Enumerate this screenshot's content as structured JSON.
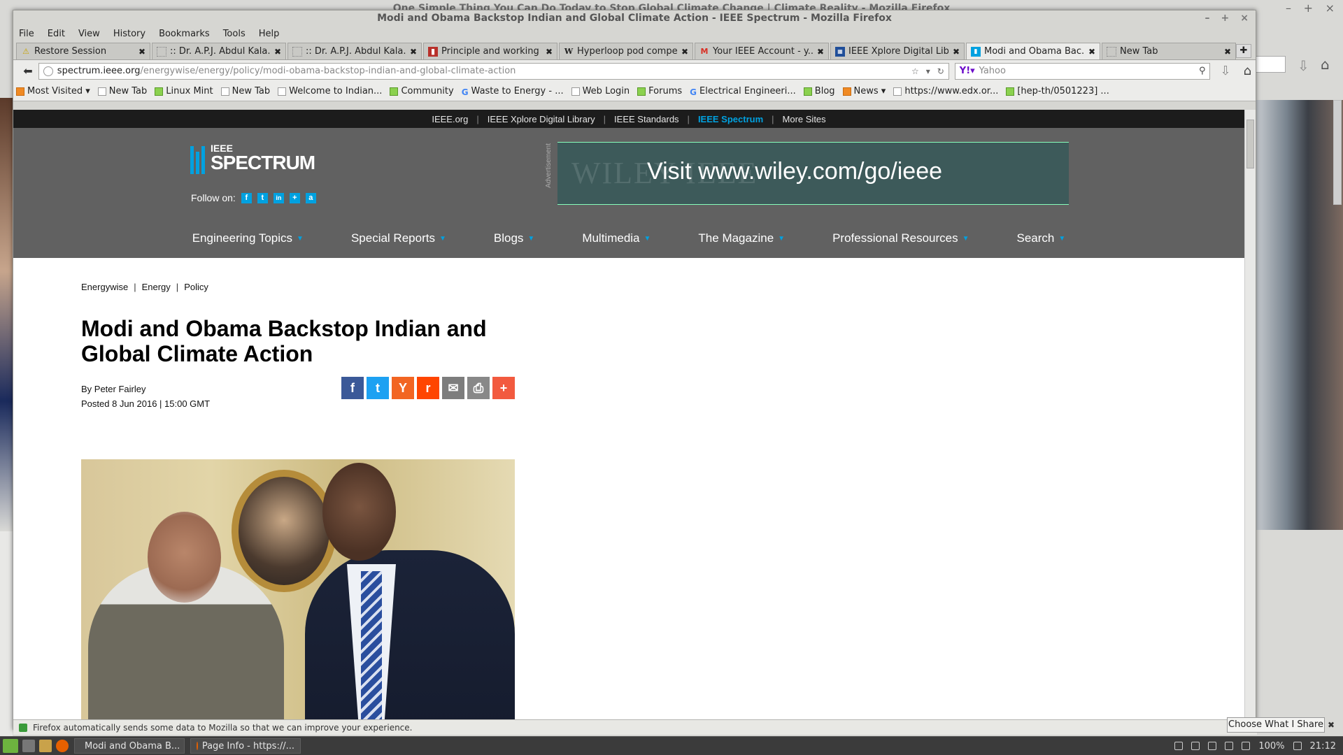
{
  "background": {
    "title": "One Simple Thing You Can Do Today to Stop Global Climate Change | Climate Reality - Mozilla Firefox"
  },
  "window": {
    "title": "Modi and Obama Backstop Indian and Global Climate Action - IEEE Spectrum - Mozilla Firefox",
    "controls": [
      "–",
      "+",
      "×"
    ]
  },
  "menu": [
    "File",
    "Edit",
    "View",
    "History",
    "Bookmarks",
    "Tools",
    "Help"
  ],
  "tabs": [
    {
      "label": "Restore Session",
      "icon": "warning-icon",
      "active": false
    },
    {
      "label": ":: Dr. A.P.J. Abdul Kala...",
      "icon": "page-icon",
      "active": false
    },
    {
      "label": ":: Dr. A.P.J. Abdul Kala...",
      "icon": "page-icon",
      "active": false
    },
    {
      "label": "Principle and working ...",
      "icon": "pdf-icon",
      "active": false
    },
    {
      "label": "Hyperloop pod compe...",
      "icon": "wikipedia-icon",
      "active": false
    },
    {
      "label": "Your IEEE Account - y...",
      "icon": "gmail-icon",
      "active": false
    },
    {
      "label": "IEEE Xplore Digital Lib...",
      "icon": "ieee-icon",
      "active": false
    },
    {
      "label": "Modi and Obama Bac...",
      "icon": "spectrum-icon",
      "active": true
    },
    {
      "label": "New Tab",
      "icon": "page-icon",
      "active": false
    }
  ],
  "url": {
    "host": "spectrum.ieee.org",
    "path": "/energywise/energy/policy/modi-obama-backstop-indian-and-global-climate-action"
  },
  "search": {
    "placeholder": "Yahoo"
  },
  "bookmarks": [
    {
      "label": "Most Visited ▾",
      "icon": "rss"
    },
    {
      "label": "New Tab",
      "icon": "page"
    },
    {
      "label": "Linux Mint",
      "icon": "green"
    },
    {
      "label": "New Tab",
      "icon": "page"
    },
    {
      "label": "Welcome to Indian...",
      "icon": "page"
    },
    {
      "label": "Community",
      "icon": "green"
    },
    {
      "label": "Waste to Energy - ...",
      "icon": "g"
    },
    {
      "label": "Web Login",
      "icon": "page"
    },
    {
      "label": "Forums",
      "icon": "green"
    },
    {
      "label": "Electrical Engineeri...",
      "icon": "g"
    },
    {
      "label": "Blog",
      "icon": "green"
    },
    {
      "label": "News ▾",
      "icon": "rss"
    },
    {
      "label": "https://www.edx.or...",
      "icon": "page"
    },
    {
      "label": "[hep-th/0501223] ...",
      "icon": "green"
    }
  ],
  "site": {
    "topnav": [
      "IEEE.org",
      "IEEE Xplore Digital Library",
      "IEEE Standards",
      "IEEE Spectrum",
      "More Sites"
    ],
    "topnav_active": "IEEE Spectrum",
    "logo_top": "IEEE",
    "logo_main": "SPECTRUM",
    "follow_label": "Follow on:",
    "social": [
      "f",
      "t",
      "in",
      "+",
      "a"
    ],
    "ad_side_label": "Advertisement",
    "ad_text": "Visit www.wiley.com/go/ieee",
    "ad_bg_text": "WILEY                    IEEE",
    "mainnav": [
      "Engineering Topics",
      "Special Reports",
      "Blogs",
      "Multimedia",
      "The Magazine",
      "Professional Resources",
      "Search"
    ]
  },
  "article": {
    "crumbs": [
      "Energywise",
      "Energy",
      "Policy"
    ],
    "headline": "Modi and Obama Backstop Indian and Global Climate Action",
    "author": "By Peter Fairley",
    "posted": "Posted 8 Jun 2016 | 15:00 GMT",
    "share": [
      {
        "name": "facebook-share-button",
        "glyph": "f",
        "color": "#3b5998"
      },
      {
        "name": "twitter-share-button",
        "glyph": "t",
        "color": "#1da1f2"
      },
      {
        "name": "hackernews-share-button",
        "glyph": "Y",
        "color": "#f26522"
      },
      {
        "name": "reddit-share-button",
        "glyph": "r",
        "color": "#ff4500"
      },
      {
        "name": "email-share-button",
        "glyph": "✉",
        "color": "#7d7d7d"
      },
      {
        "name": "print-share-button",
        "glyph": "⎙",
        "color": "#888888"
      },
      {
        "name": "more-share-button",
        "glyph": "+",
        "color": "#f25a3f"
      }
    ]
  },
  "notification": {
    "text": "Firefox automatically sends some data to Mozilla so that we can improve your experience.",
    "button": "Choose What I Share"
  },
  "taskbar": {
    "tasks": [
      "Modi and Obama B...",
      "Page Info - https://..."
    ],
    "battery": "100%",
    "clock": "21:12"
  }
}
